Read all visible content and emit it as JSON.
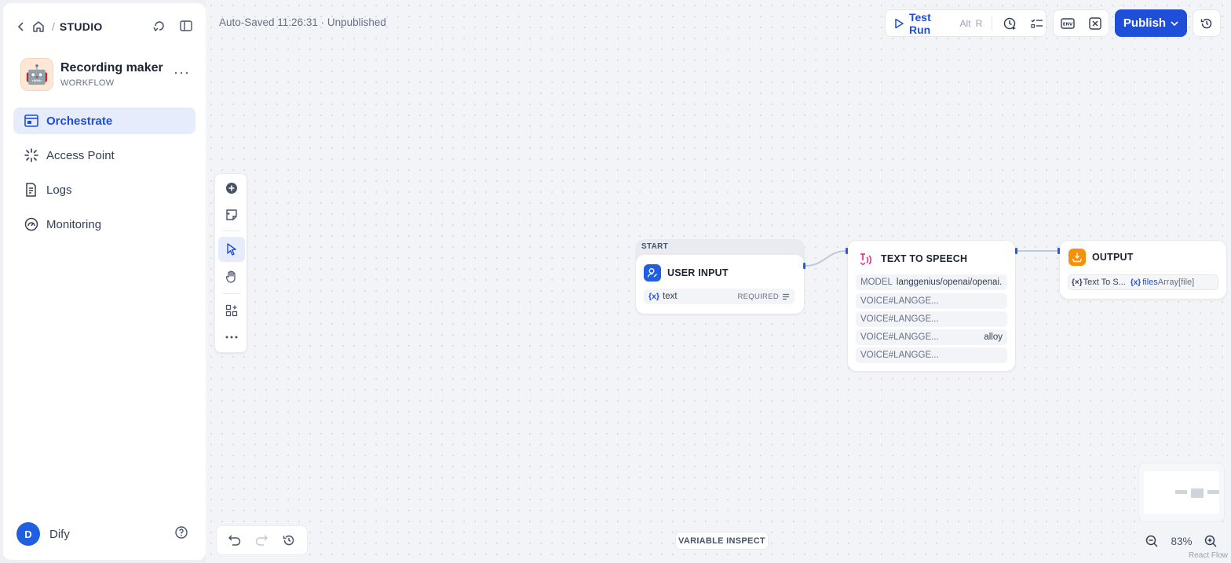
{
  "sidebar": {
    "breadcrumb_label": "STUDIO",
    "app": {
      "avatar_emoji": "🤖",
      "name": "Recording maker",
      "type": "WORKFLOW",
      "more": "···"
    },
    "nav": [
      {
        "label": "Orchestrate",
        "icon": "orchestrate-icon",
        "active": true
      },
      {
        "label": "Access Point",
        "icon": "access-point-icon",
        "active": false
      },
      {
        "label": "Logs",
        "icon": "logs-icon",
        "active": false
      },
      {
        "label": "Monitoring",
        "icon": "monitoring-icon",
        "active": false
      }
    ],
    "user": {
      "initial": "D",
      "name": "Dify"
    }
  },
  "header": {
    "autosave": "Auto-Saved 11:26:31 · Unpublished",
    "test_run_label": "Test Run",
    "test_run_kbd_1": "Alt",
    "test_run_kbd_2": "R",
    "publish_label": "Publish"
  },
  "nodes": {
    "start": {
      "group_label": "START",
      "title": "USER INPUT",
      "var_icon": "{x}",
      "var_name": "text",
      "var_tag": "REQUIRED"
    },
    "tts": {
      "title": "TEXT TO SPEECH",
      "model_key": "MODEL",
      "model_value": "langgenius/openai/openai...",
      "rows": [
        {
          "key": "VOICE#LANGGE...",
          "value": ""
        },
        {
          "key": "VOICE#LANGGE...",
          "value": ""
        },
        {
          "key": "VOICE#LANGGE...",
          "value": "alloy"
        },
        {
          "key": "VOICE#LANGGE...",
          "value": ""
        }
      ]
    },
    "output": {
      "title": "OUTPUT",
      "var_icon": "{x}",
      "source": "Text To S...",
      "var_name": "files",
      "var_type": "Array[file]"
    }
  },
  "canvas": {
    "variable_inspect": "VARIABLE INSPECT",
    "zoom": "83%",
    "attribution": "React Flow"
  },
  "colors": {
    "accent": "#1f4ed8",
    "output_icon": "#f79009",
    "tts_icon": "#dd2590"
  }
}
